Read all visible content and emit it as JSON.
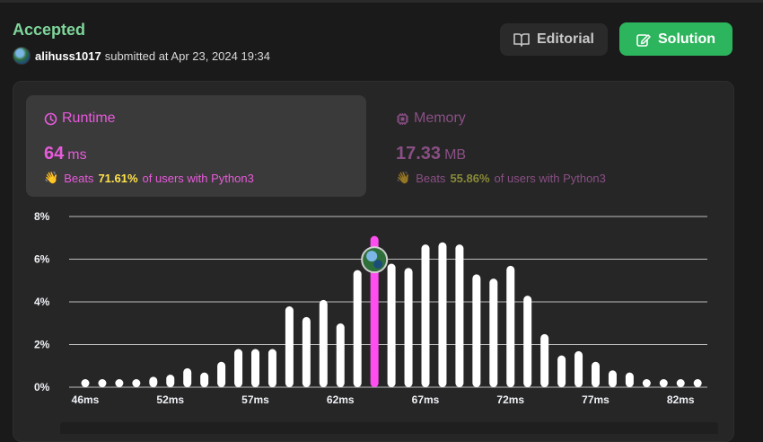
{
  "status": "Accepted",
  "submission": {
    "user": "alihuss1017",
    "text": "submitted at Apr 23, 2024 19:34"
  },
  "buttons": {
    "editorial": "Editorial",
    "solution": "Solution"
  },
  "runtime": {
    "title": "Runtime",
    "value": "64",
    "unit": "ms",
    "beats_prefix": "Beats",
    "beats_pct": "71.61%",
    "beats_suffix": "of users with Python3"
  },
  "memory": {
    "title": "Memory",
    "value": "17.33",
    "unit": "MB",
    "beats_prefix": "Beats",
    "beats_pct": "55.86%",
    "beats_suffix": "of users with Python3"
  },
  "colors": {
    "accepted": "#7ed69a",
    "runtime": "#e85adc",
    "memory": "#8a4f85",
    "solution_button": "#2db55d",
    "bar": "#ffffff",
    "highlight_bar": "#ff4df0"
  },
  "chart_data": {
    "type": "bar",
    "ylim": [
      0,
      8
    ],
    "yticks": [
      "8%",
      "6%",
      "4%",
      "2%",
      "0%"
    ],
    "ytick_values": [
      8,
      6,
      4,
      2,
      0
    ],
    "xtick_labels": [
      "46ms",
      "52ms",
      "57ms",
      "62ms",
      "67ms",
      "72ms",
      "77ms",
      "82ms"
    ],
    "xtick_indices": [
      0,
      5,
      10,
      15,
      20,
      25,
      30,
      35
    ],
    "values": [
      0.1,
      0.1,
      0.1,
      0.1,
      0.3,
      0.4,
      0.7,
      0.5,
      1.0,
      1.6,
      1.6,
      1.6,
      3.6,
      3.1,
      3.9,
      2.8,
      5.3,
      6.9,
      5.6,
      5.4,
      6.5,
      6.6,
      6.5,
      5.1,
      4.9,
      5.5,
      4.1,
      2.3,
      1.3,
      1.5,
      1.0,
      0.6,
      0.5,
      0.1,
      0.1,
      0.1,
      0.1
    ],
    "highlight_index": 17,
    "grid": true
  }
}
